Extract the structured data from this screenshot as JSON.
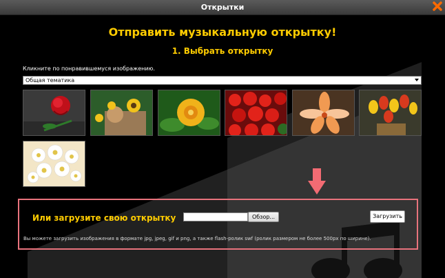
{
  "window": {
    "title": "Открытки"
  },
  "header": {
    "title": "Отправить музыкальную открытку!",
    "step": "1. Выбрать открытку",
    "hint": "Кликните по понравившемуся изображению."
  },
  "category_select": {
    "value": "Общая тематика"
  },
  "cards": [
    {
      "name": "red-rose",
      "palette": [
        "#3a3a3a",
        "#c0101a",
        "#2e7a2a"
      ]
    },
    {
      "name": "teddy-bear-sunflowers",
      "palette": [
        "#2c5d2a",
        "#f1c21b",
        "#9a7a56"
      ]
    },
    {
      "name": "yellow-flower",
      "palette": [
        "#1f5a1a",
        "#f0b21a",
        "#3e8b2c"
      ]
    },
    {
      "name": "red-flowers",
      "palette": [
        "#6a0c0c",
        "#e2231a",
        "#2d6b24"
      ]
    },
    {
      "name": "lily",
      "palette": [
        "#4a3422",
        "#f19a52",
        "#f7c59a"
      ]
    },
    {
      "name": "tulips-bouquet",
      "palette": [
        "#3a3a2c",
        "#f2c51a",
        "#d83a1e"
      ]
    },
    {
      "name": "daisies",
      "palette": [
        "#f3e6c7",
        "#ffffff",
        "#e1c44a"
      ]
    }
  ],
  "upload": {
    "title": "Или загрузите свою открытку",
    "browse_label": "Обзор...",
    "submit_label": "Загрузить",
    "note": "Вы можете загрузить изображения в формате jpg, jpeg, gif и png, а также flash-ролик swf (ролик размером не более 500px по ширине)."
  },
  "colors": {
    "accent": "#ffcc00",
    "highlight_border": "#e9737d",
    "arrow": "#f36b73",
    "close": "#ff6a00"
  }
}
